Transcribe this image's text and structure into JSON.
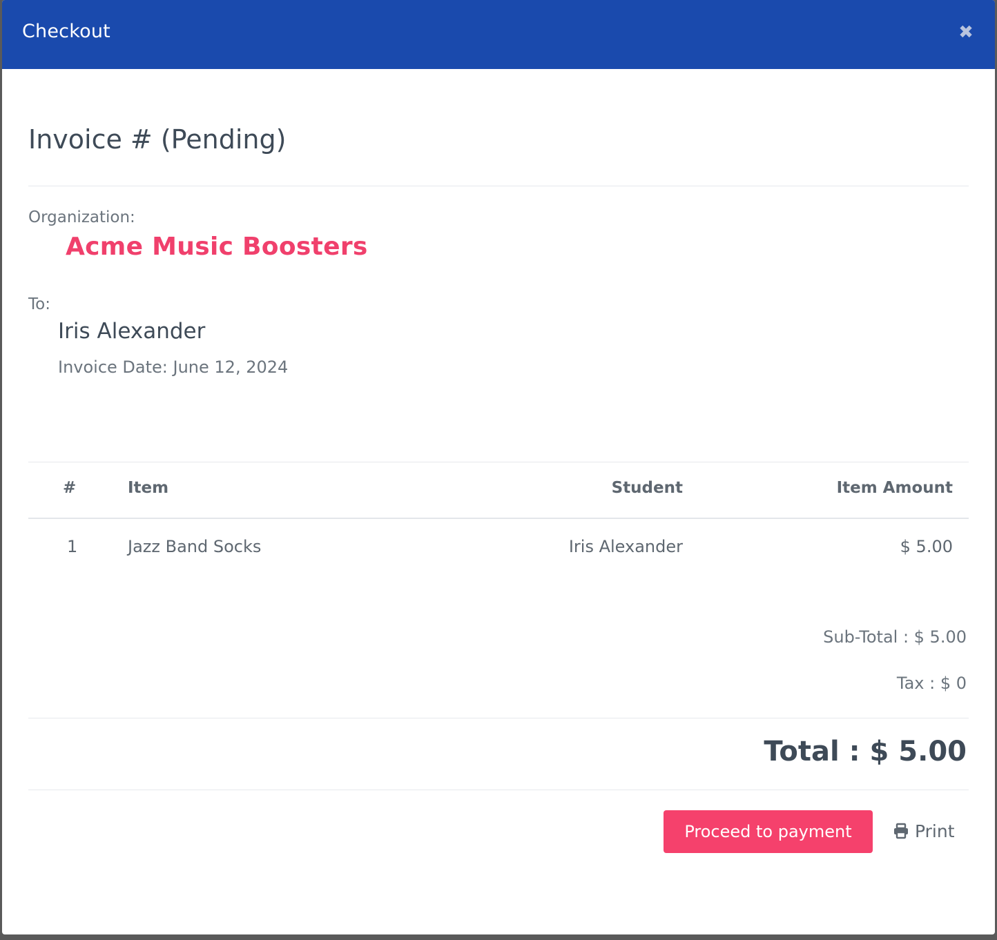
{
  "modal": {
    "title": "Checkout",
    "close_icon": "close-icon"
  },
  "invoice": {
    "heading": "Invoice # (Pending)",
    "organization_label": "Organization:",
    "organization_name": "Acme Music Boosters",
    "to_label": "To:",
    "to_name": "Iris Alexander",
    "invoice_date": "Invoice Date: June 12, 2024"
  },
  "table": {
    "headers": [
      "#",
      "Item",
      "Student",
      "Item Amount"
    ],
    "rows": [
      {
        "num": "1",
        "item": "Jazz Band Socks",
        "student": "Iris Alexander",
        "amount": "$ 5.00"
      }
    ]
  },
  "totals": {
    "subtotal": "Sub-Total : $ 5.00",
    "tax": "Tax : $ 0",
    "total": "Total : $ 5.00"
  },
  "actions": {
    "pay_label": "Proceed to payment",
    "print_label": "Print",
    "print_icon": "printer-icon"
  },
  "colors": {
    "header_bg": "#1a4aad",
    "accent": "#f5416c",
    "org_name": "#f0406c"
  }
}
